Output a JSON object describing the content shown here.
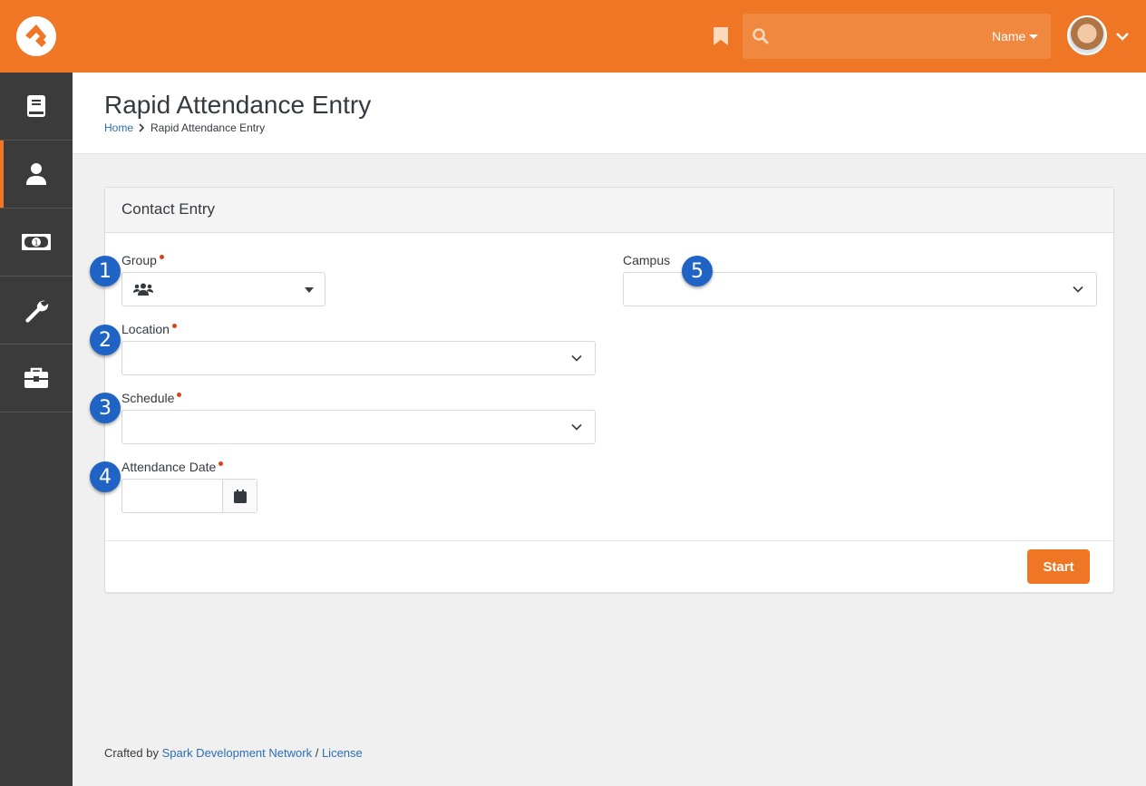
{
  "header": {
    "search_type": "Name",
    "search_placeholder": "",
    "brand_color": "#ee7624"
  },
  "sidebar": {
    "items": [
      {
        "name": "book",
        "active": false
      },
      {
        "name": "person",
        "active": true
      },
      {
        "name": "money",
        "active": false
      },
      {
        "name": "wrench",
        "active": false
      },
      {
        "name": "briefcase",
        "active": false
      }
    ]
  },
  "page": {
    "title": "Rapid Attendance Entry",
    "breadcrumb": [
      "Home",
      "Rapid Attendance Entry"
    ]
  },
  "panel": {
    "title": "Contact Entry",
    "fields": {
      "group": {
        "label": "Group",
        "required": true,
        "value": ""
      },
      "location": {
        "label": "Location",
        "required": true,
        "value": ""
      },
      "schedule": {
        "label": "Schedule",
        "required": true,
        "value": ""
      },
      "attendance_date": {
        "label": "Attendance Date",
        "required": true,
        "value": ""
      },
      "campus": {
        "label": "Campus",
        "required": false,
        "value": ""
      }
    },
    "start_label": "Start"
  },
  "callouts": [
    "1",
    "2",
    "3",
    "4",
    "5"
  ],
  "footer": {
    "prefix": "Crafted by",
    "link1": "Spark Development Network",
    "separator": "/",
    "link2": "License"
  }
}
